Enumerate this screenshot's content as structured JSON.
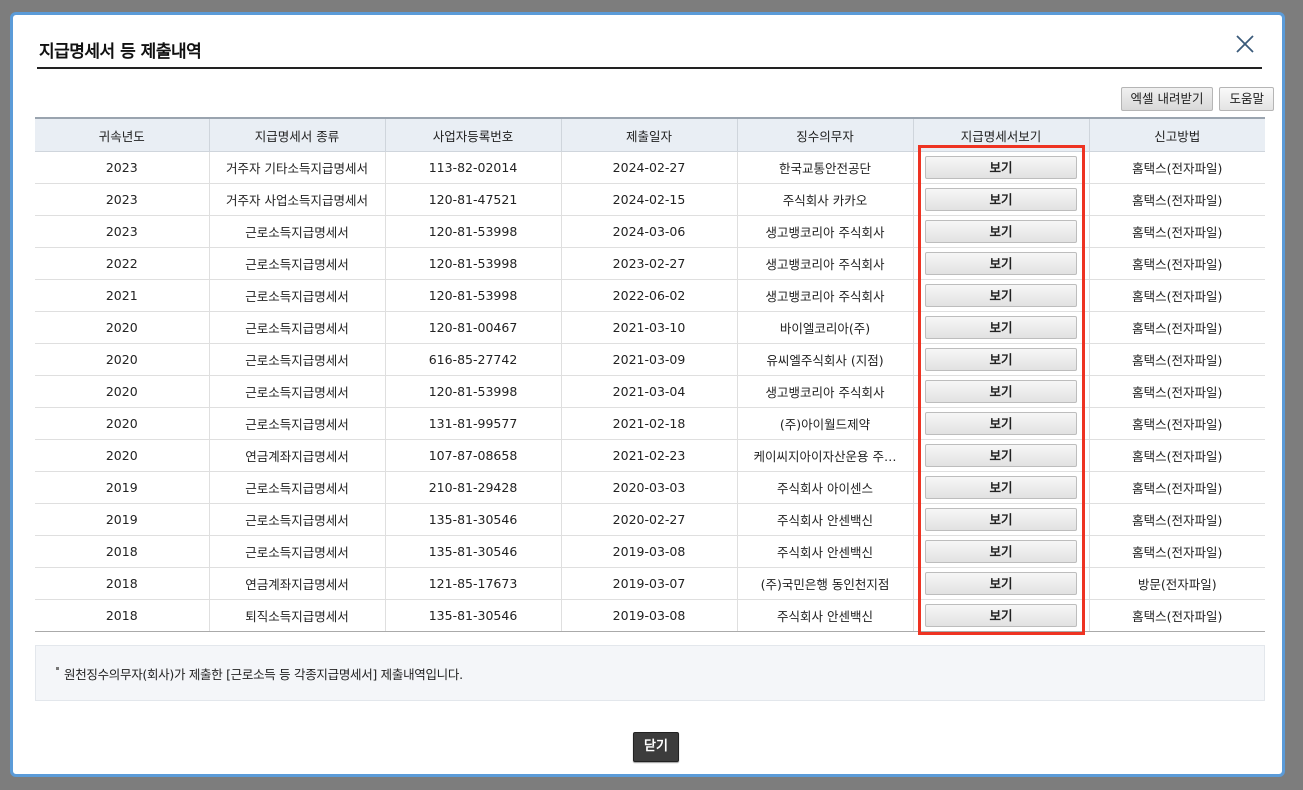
{
  "dialog": {
    "title": "지급명세서 등 제출내역"
  },
  "toolbar": {
    "excel_label": "엑셀 내려받기",
    "help_label": "도움말"
  },
  "table": {
    "headers": [
      "귀속년도",
      "지급명세서 종류",
      "사업자등록번호",
      "제출일자",
      "징수의무자",
      "지급명세서보기",
      "신고방법"
    ],
    "view_label": "보기",
    "rows": [
      {
        "year": "2023",
        "type": "거주자 기타소득지급명세서",
        "bizno": "113-82-02014",
        "date": "2024-02-27",
        "payer": "한국교통안전공단",
        "method": "홈택스(전자파일)"
      },
      {
        "year": "2023",
        "type": "거주자 사업소득지급명세서",
        "bizno": "120-81-47521",
        "date": "2024-02-15",
        "payer": "주식회사 카카오",
        "method": "홈택스(전자파일)"
      },
      {
        "year": "2023",
        "type": "근로소득지급명세서",
        "bizno": "120-81-53998",
        "date": "2024-03-06",
        "payer": "생고뱅코리아 주식회사",
        "method": "홈택스(전자파일)"
      },
      {
        "year": "2022",
        "type": "근로소득지급명세서",
        "bizno": "120-81-53998",
        "date": "2023-02-27",
        "payer": "생고뱅코리아 주식회사",
        "method": "홈택스(전자파일)"
      },
      {
        "year": "2021",
        "type": "근로소득지급명세서",
        "bizno": "120-81-53998",
        "date": "2022-06-02",
        "payer": "생고뱅코리아 주식회사",
        "method": "홈택스(전자파일)"
      },
      {
        "year": "2020",
        "type": "근로소득지급명세서",
        "bizno": "120-81-00467",
        "date": "2021-03-10",
        "payer": "바이엘코리아(주)",
        "method": "홈택스(전자파일)"
      },
      {
        "year": "2020",
        "type": "근로소득지급명세서",
        "bizno": "616-85-27742",
        "date": "2021-03-09",
        "payer": "유씨엘주식회사 (지점)",
        "method": "홈택스(전자파일)"
      },
      {
        "year": "2020",
        "type": "근로소득지급명세서",
        "bizno": "120-81-53998",
        "date": "2021-03-04",
        "payer": "생고뱅코리아 주식회사",
        "method": "홈택스(전자파일)"
      },
      {
        "year": "2020",
        "type": "근로소득지급명세서",
        "bizno": "131-81-99577",
        "date": "2021-02-18",
        "payer": "(주)아이월드제약",
        "method": "홈택스(전자파일)"
      },
      {
        "year": "2020",
        "type": "연금계좌지급명세서",
        "bizno": "107-87-08658",
        "date": "2021-02-23",
        "payer": "케이씨지아이자산운용 주…",
        "method": "홈택스(전자파일)"
      },
      {
        "year": "2019",
        "type": "근로소득지급명세서",
        "bizno": "210-81-29428",
        "date": "2020-03-03",
        "payer": "주식회사 아이센스",
        "method": "홈택스(전자파일)"
      },
      {
        "year": "2019",
        "type": "근로소득지급명세서",
        "bizno": "135-81-30546",
        "date": "2020-02-27",
        "payer": "주식회사 안센백신",
        "method": "홈택스(전자파일)"
      },
      {
        "year": "2018",
        "type": "근로소득지급명세서",
        "bizno": "135-81-30546",
        "date": "2019-03-08",
        "payer": "주식회사 안센백신",
        "method": "홈택스(전자파일)"
      },
      {
        "year": "2018",
        "type": "연금계좌지급명세서",
        "bizno": "121-85-17673",
        "date": "2019-03-07",
        "payer": "(주)국민은행 동인천지점",
        "method": "방문(전자파일)"
      },
      {
        "year": "2018",
        "type": "퇴직소득지급명세서",
        "bizno": "135-81-30546",
        "date": "2019-03-08",
        "payer": "주식회사 안센백신",
        "method": "홈택스(전자파일)"
      }
    ]
  },
  "notice": {
    "text": "원천징수의무자(회사)가 제출한 [근로소득 등 각종지급명세서] 제출내역입니다."
  },
  "footer": {
    "close_label": "닫기"
  },
  "colors": {
    "modal_border": "#5b9bd8",
    "highlight": "#ee3322",
    "header_bg": "#e9eef4"
  },
  "icons": {
    "close": "close-icon"
  }
}
